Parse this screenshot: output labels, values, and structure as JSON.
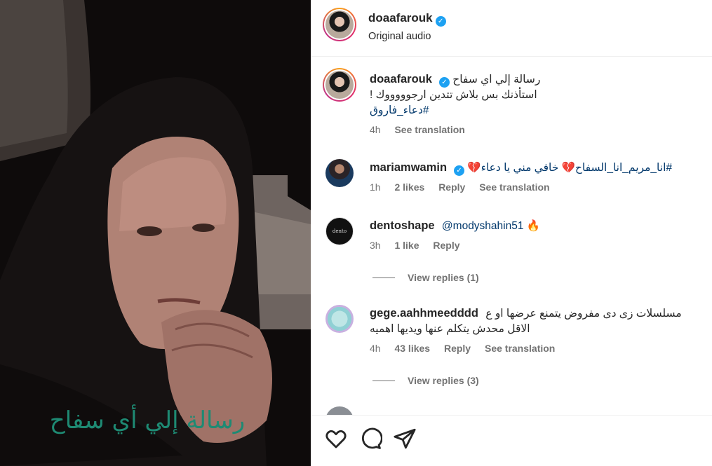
{
  "media": {
    "overlay_text": "رسالة إلي أي سفاح"
  },
  "header": {
    "username": "doaafarouk",
    "subtitle": "Original audio"
  },
  "caption": {
    "username": "doaafarouk",
    "line1": "رسالة إلي اي سفاح",
    "line2": "استأذنك بس بلاش تتدين ارجوووووك !",
    "hashtag": "#دعاء_فاروق",
    "time": "4h",
    "see_translation": "See translation"
  },
  "comments": [
    {
      "username": "mariamwamin",
      "verified": true,
      "text": "#انا_مريم_انا_السفاح💔 خافي مني يا دعاء💔",
      "time": "1h",
      "likes": "2 likes",
      "reply": "Reply",
      "see_translation": "See translation"
    },
    {
      "username": "dentoshape",
      "verified": false,
      "text": "@modyshahin51 🔥",
      "time": "3h",
      "likes": "1 like",
      "reply": "Reply",
      "view_replies": "View replies (1)"
    },
    {
      "username": "gege.aahhmeedddd",
      "verified": false,
      "text": "مسلسلات زى دى مفروض يتمنع عرضها او ع الاقل محدش يتكلم عنها ويديها اهميه",
      "time": "4h",
      "likes": "43 likes",
      "reply": "Reply",
      "see_translation": "See translation",
      "view_replies": "View replies (3)"
    }
  ],
  "icons": [
    "heart-icon",
    "comment-icon",
    "share-icon"
  ],
  "colors": {
    "verified": "#1da1f2",
    "overlay_text": "#1e8a73",
    "hashtag": "#00376b"
  }
}
